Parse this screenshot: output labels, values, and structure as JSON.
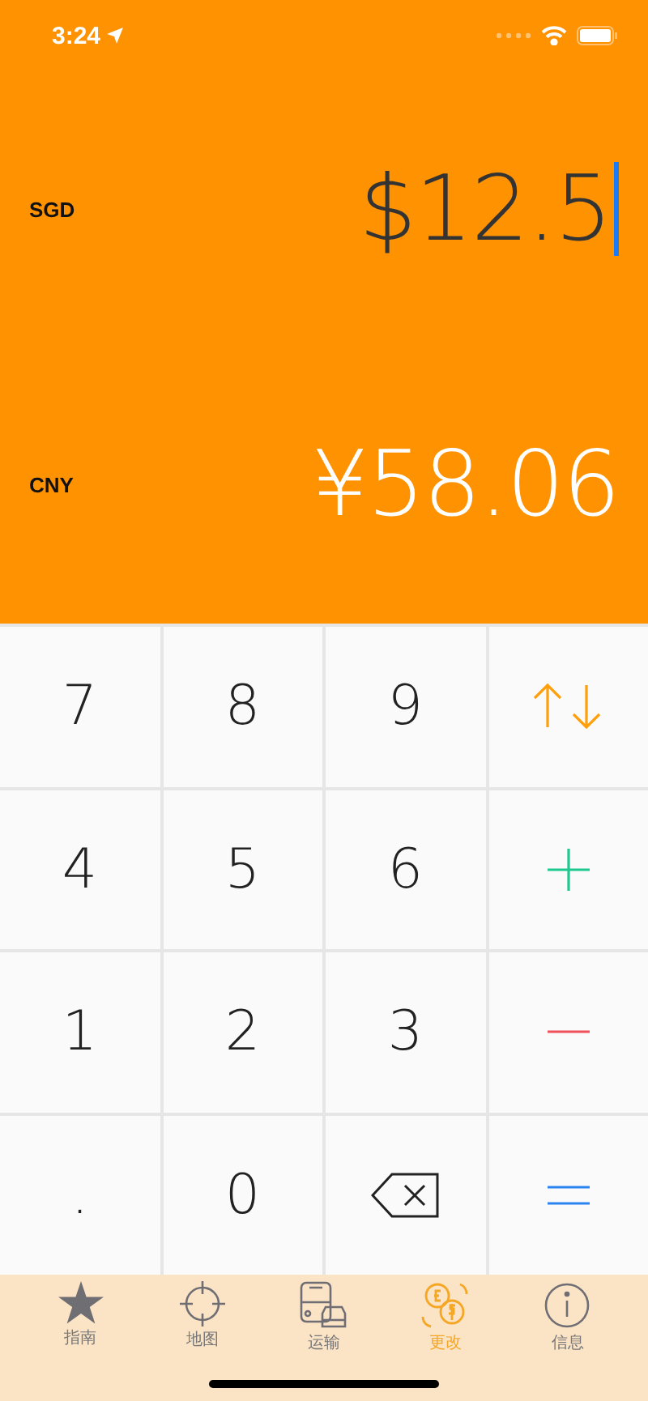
{
  "status_bar": {
    "time": "3:24"
  },
  "conversions": [
    {
      "currency": "SGD",
      "amount": "$12.5",
      "active": true
    },
    {
      "currency": "CNY",
      "amount": "¥58.06",
      "active": false
    }
  ],
  "keypad": [
    [
      {
        "kind": "digit",
        "label": "7"
      },
      {
        "kind": "digit",
        "label": "8"
      },
      {
        "kind": "digit",
        "label": "9"
      },
      {
        "kind": "swap"
      }
    ],
    [
      {
        "kind": "digit",
        "label": "4"
      },
      {
        "kind": "digit",
        "label": "5"
      },
      {
        "kind": "digit",
        "label": "6"
      },
      {
        "kind": "plus"
      }
    ],
    [
      {
        "kind": "digit",
        "label": "1"
      },
      {
        "kind": "digit",
        "label": "2"
      },
      {
        "kind": "digit",
        "label": "3"
      },
      {
        "kind": "minus"
      }
    ],
    [
      {
        "kind": "digit",
        "label": "."
      },
      {
        "kind": "digit",
        "label": "0"
      },
      {
        "kind": "backspace"
      },
      {
        "kind": "equals"
      }
    ]
  ],
  "tab_bar": [
    {
      "kind": "star",
      "label": "指南",
      "selected": false
    },
    {
      "kind": "crosshair",
      "label": "地图",
      "selected": false
    },
    {
      "kind": "transport",
      "label": "运输",
      "selected": false
    },
    {
      "kind": "exchange",
      "label": "更改",
      "selected": true
    },
    {
      "kind": "info",
      "label": "信息",
      "selected": false
    }
  ]
}
